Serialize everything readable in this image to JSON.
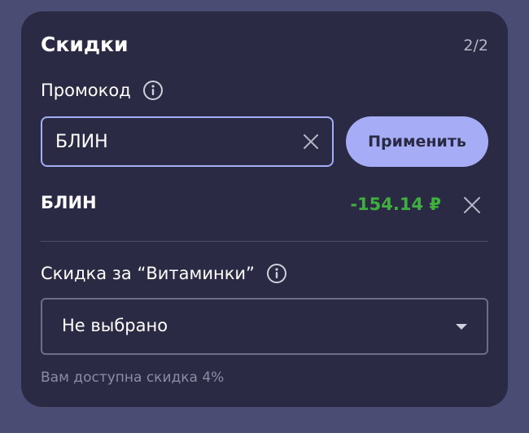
{
  "colors": {
    "background": "#4a4c73",
    "card": "#2b2a44",
    "accent": "#a6acf6",
    "discount_amount": "#3fae3f",
    "muted_text": "#8d8ca3"
  },
  "discounts": {
    "title": "Скидки",
    "counter": "2/2",
    "promo": {
      "label": "Промокод",
      "info_icon": "info-icon",
      "input_value": "БЛИН",
      "clear_icon": "close-icon",
      "apply_label": "Применить"
    },
    "applied": {
      "code": "БЛИН",
      "amount": "-154.14 ₽",
      "remove_icon": "close-icon"
    },
    "vitamins": {
      "label": "Скидка за “Витаминки”",
      "info_icon": "info-icon",
      "selected": "Не выбрано",
      "caret_icon": "caret-down-icon",
      "hint": "Вам доступна скидка 4%"
    }
  }
}
